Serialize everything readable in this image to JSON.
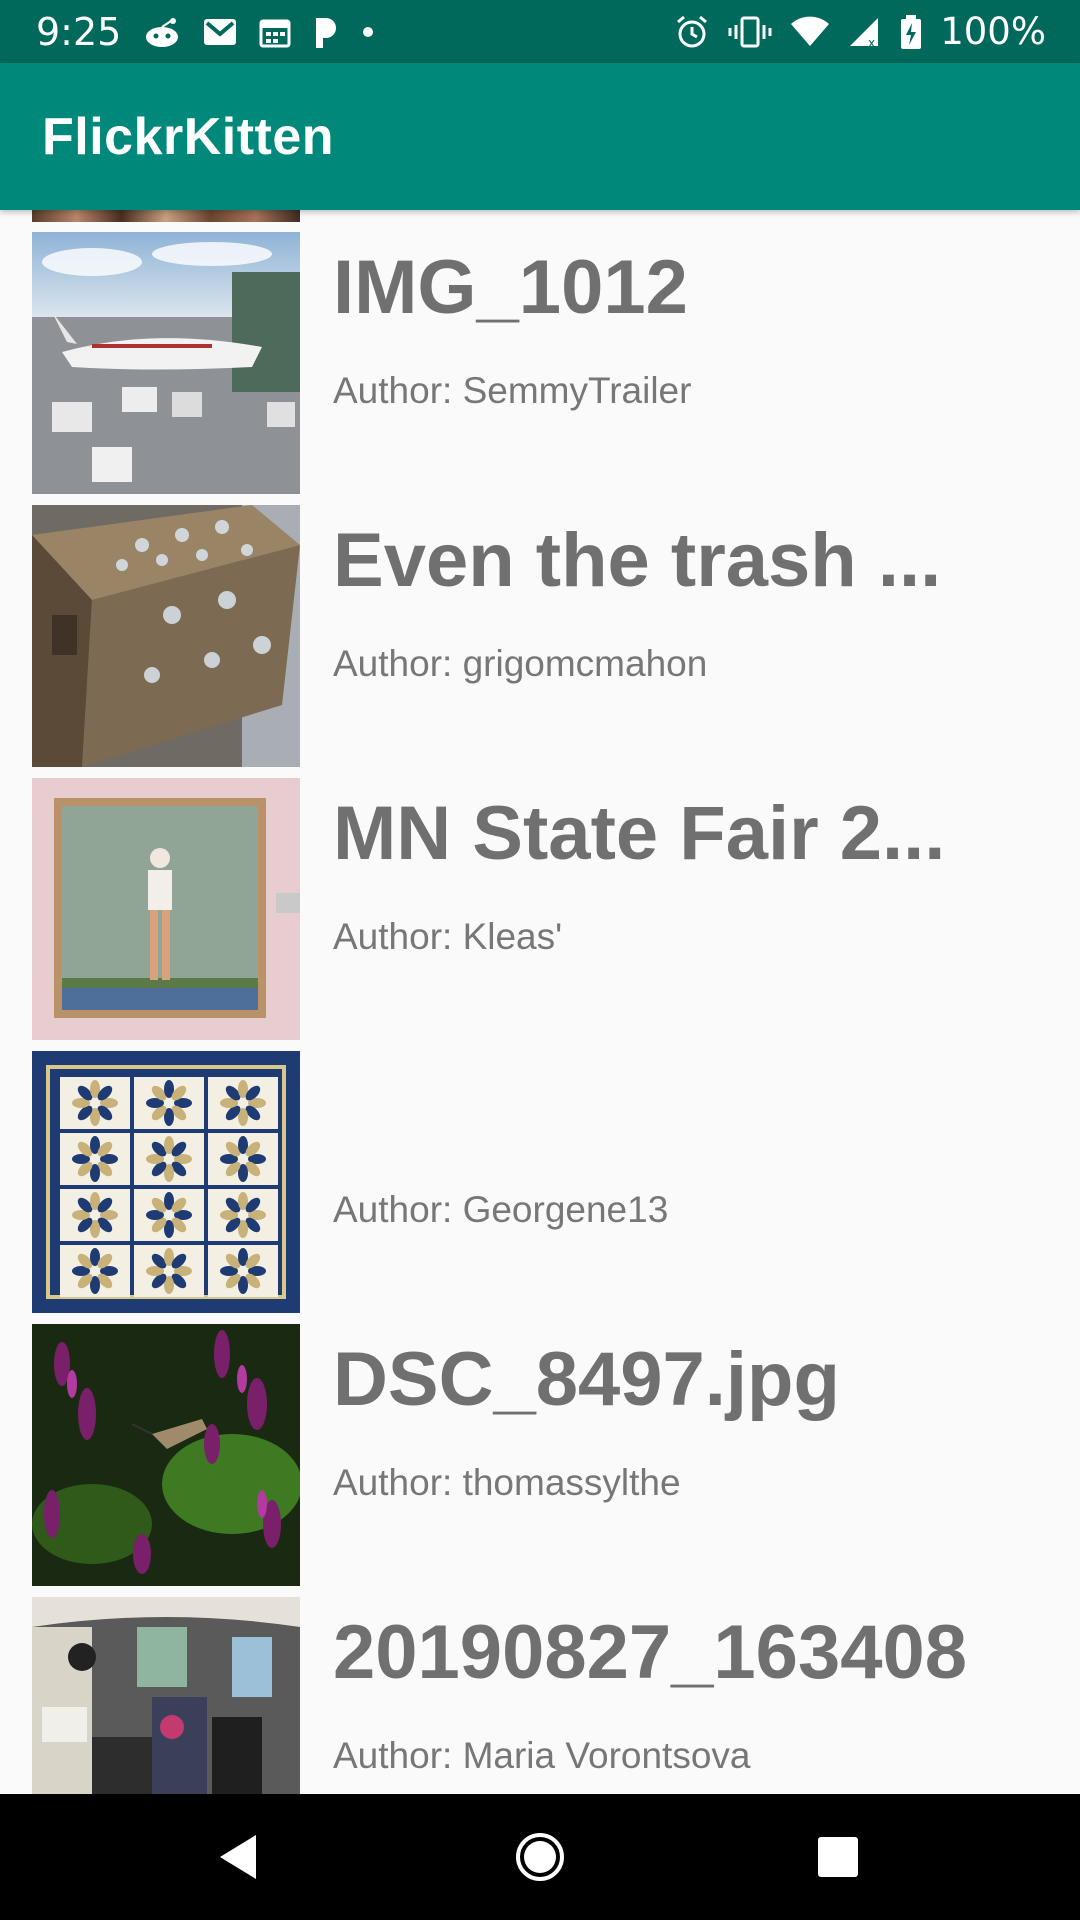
{
  "status_bar": {
    "time": "9:25",
    "battery": "100%",
    "icons_left": [
      "reddit-icon",
      "gmail-icon",
      "calendar-icon",
      "pandora-icon",
      "dot-icon"
    ],
    "icons_right": [
      "alarm-icon",
      "vibrate-icon",
      "wifi-icon",
      "signal-icon",
      "battery-icon"
    ]
  },
  "app_bar": {
    "title": "FlickrKitten",
    "background": "#00897b",
    "status_background": "#00695c"
  },
  "list": {
    "items": [
      {
        "title": "IMG_1012",
        "author": "Author: SemmyTrailer",
        "thumbnail": "airport-airplane-photo"
      },
      {
        "title": "Even the trash ...",
        "author": "Author: grigomcmahon",
        "thumbnail": "patterned-trash-bin-photo"
      },
      {
        "title": "MN State Fair 2...",
        "author": "Author: Kleas'",
        "thumbnail": "framed-painting-photo"
      },
      {
        "title": "",
        "author": "Author: Georgene13",
        "thumbnail": "blue-quilt-photo"
      },
      {
        "title": "DSC_8497.jpg",
        "author": "Author: thomassylthe",
        "thumbnail": "purple-flowers-hummingbird-photo"
      },
      {
        "title": "20190827_163408",
        "author": "Author: Maria Vorontsova",
        "thumbnail": "vehicle-interior-photo"
      }
    ]
  },
  "nav_bar": {
    "buttons": [
      "back-icon",
      "home-icon",
      "recents-icon"
    ]
  }
}
